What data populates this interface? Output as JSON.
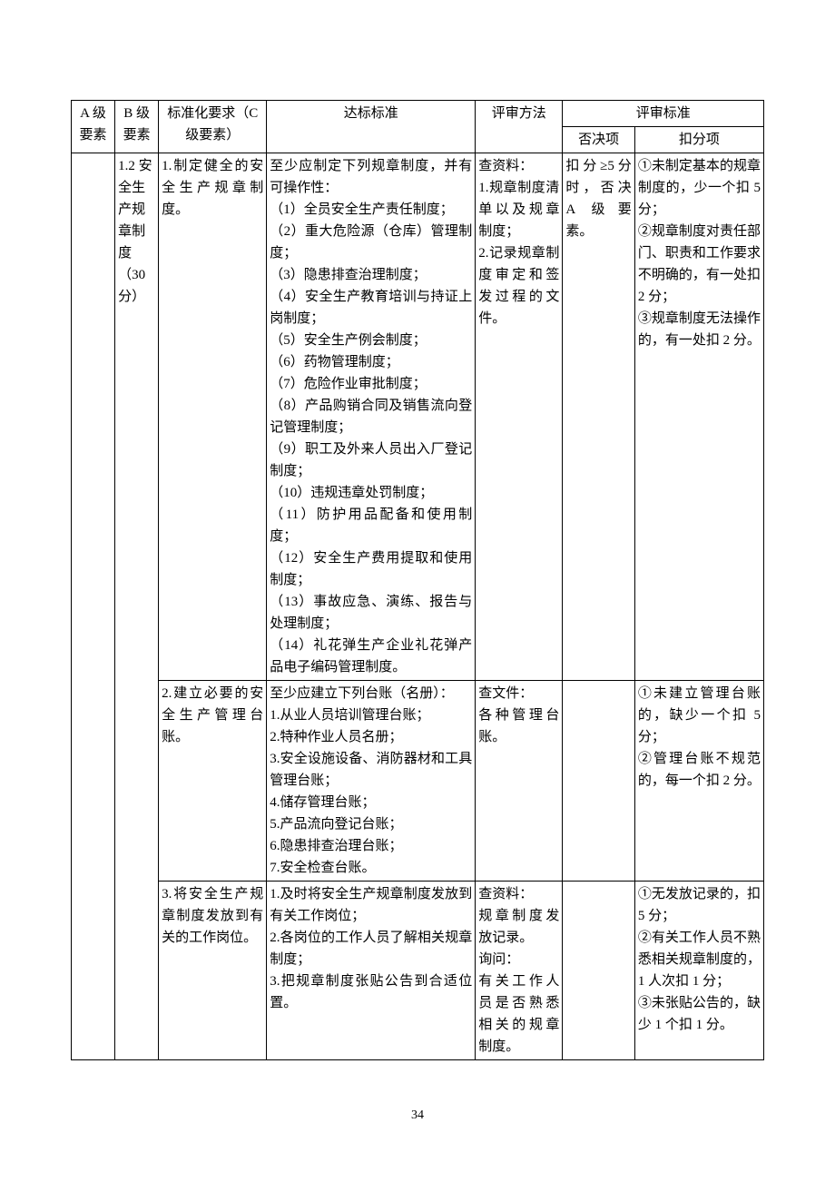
{
  "headers": {
    "a": "A 级要素",
    "b": "B 级要素",
    "c": "标准化要求（C 级要素）",
    "d": "达标标准",
    "e": "评审方法",
    "f_group": "评审标准",
    "f": "否决项",
    "g": "扣分项"
  },
  "rows": [
    {
      "b": "1.2 安全生产规章制度（30分）",
      "c": "1.制定健全的安全生产规章制度。",
      "d": "至少应制定下列规章制度，并有可操作性：\n（1）全员安全生产责任制度；\n（2）重大危险源（仓库）管理制度；\n（3）隐患排查治理制度；\n（4）安全生产教育培训与持证上岗制度；\n（5）安全生产例会制度；\n（6）药物管理制度；\n（7）危险作业审批制度；\n（8）产品购销合同及销售流向登记管理制度；\n（9）职工及外来人员出入厂登记制度；\n（10）违规违章处罚制度；\n（11）防护用品配备和使用制度；\n（12）安全生产费用提取和使用制度；\n（13）事故应急、演练、报告与处理制度；\n（14）礼花弹生产企业礼花弹产品电子编码管理制度。",
      "e": "查资料：\n1.规章制度清单以及规章制度；\n2.记录规章制度审定和签发过程的文件。",
      "f": "扣分≥5分时，否决 A 级要素。",
      "g": "①未制定基本的规章制度的，少一个扣 5 分；\n②规章制度对责任部门、职责和工作要求不明确的，有一处扣 2 分；\n③规章制度无法操作的，有一处扣 2 分。"
    },
    {
      "c": "2.建立必要的安全生产管理台账。",
      "d": "至少应建立下列台账（名册）：\n1.从业人员培训管理台账；\n2.特种作业人员名册；\n3.安全设施设备、消防器材和工具管理台账；\n4.储存管理台账；\n5.产品流向登记台账；\n6.隐患排查治理台账；\n7.安全检查台账。",
      "e": "查文件：\n各种管理台账。",
      "f": "",
      "g": "①未建立管理台账的，缺少一个扣 5 分；\n②管理台账不规范的，每一个扣 2 分。"
    },
    {
      "c": "3.将安全生产规章制度发放到有关的工作岗位。",
      "d": "1.及时将安全生产规章制度发放到有关工作岗位；\n2.各岗位的工作人员了解相关规章制度；\n3.把规章制度张贴公告到合适位置。",
      "e": "查资料：\n规章制度发放记录。\n询问：\n有关工作人员是否熟悉相关的规章制度。",
      "f": "",
      "g": "①无发放记录的，扣 5 分；\n②有关工作人员不熟悉相关规章制度的，1 人次扣 1 分；\n③未张贴公告的，缺少 1 个扣 1 分。"
    }
  ],
  "page": "34"
}
